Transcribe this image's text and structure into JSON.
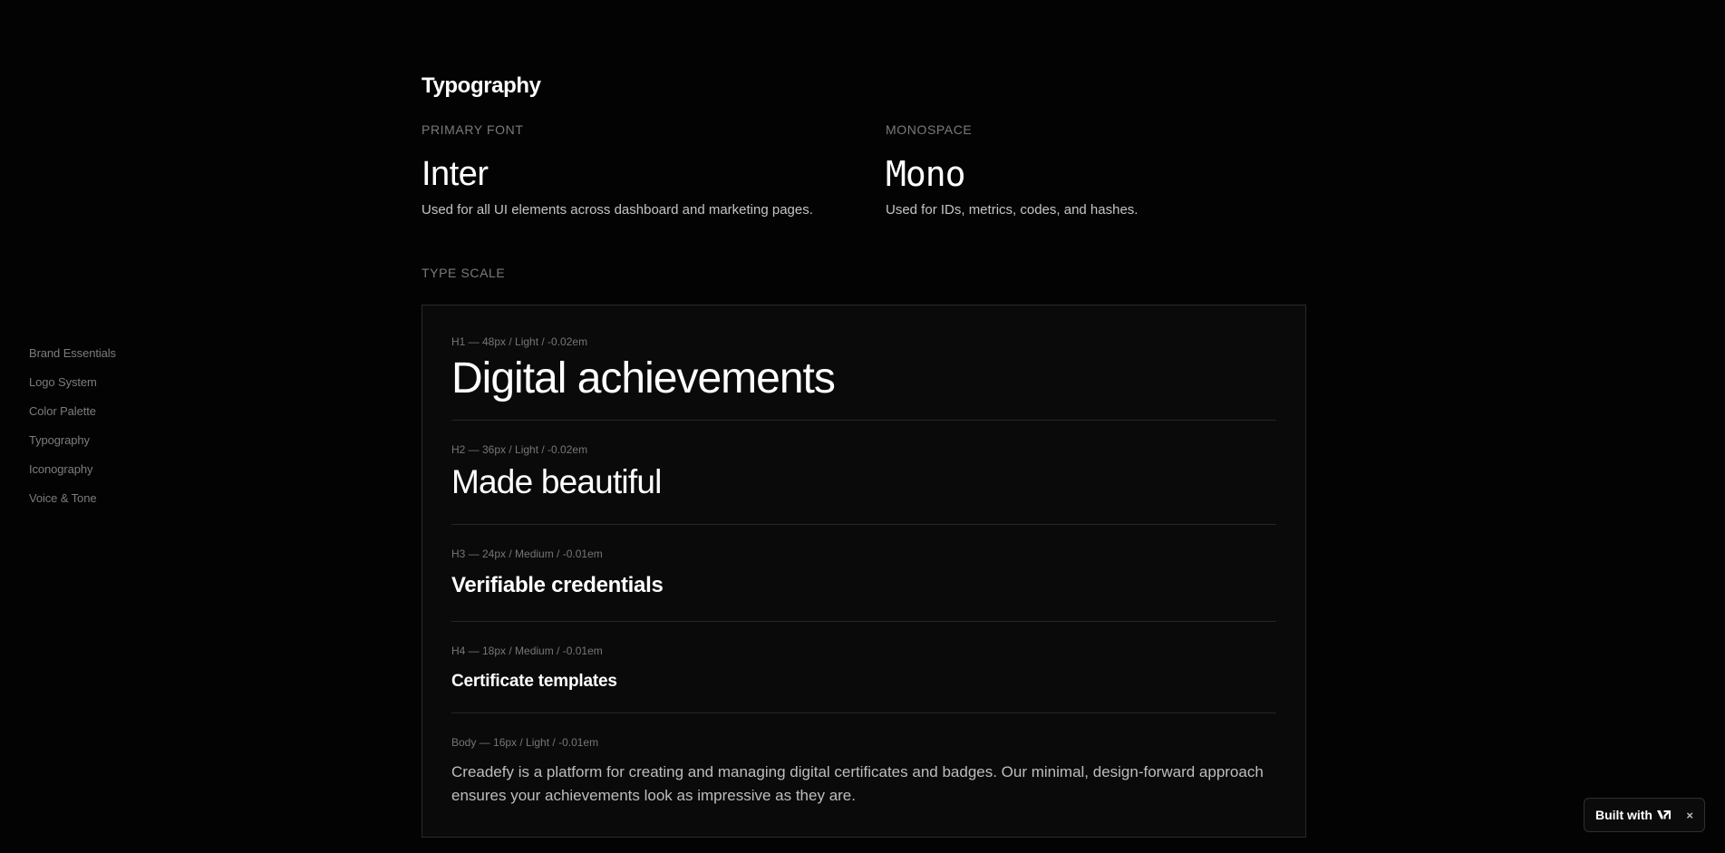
{
  "sidebar": {
    "items": [
      {
        "label": "Brand Essentials"
      },
      {
        "label": "Logo System"
      },
      {
        "label": "Color Palette"
      },
      {
        "label": "Typography"
      },
      {
        "label": "Iconography"
      },
      {
        "label": "Voice & Tone"
      }
    ]
  },
  "main": {
    "title": "Typography",
    "primary_font": {
      "eyebrow": "PRIMARY FONT",
      "name": "Inter",
      "description": "Used for all UI elements across dashboard and marketing pages."
    },
    "monospace_font": {
      "eyebrow": "MONOSPACE",
      "name": "Mono",
      "description": "Used for IDs, metrics, codes, and hashes."
    },
    "type_scale": {
      "label": "TYPE SCALE",
      "rows": [
        {
          "spec": "H1 — 48px / Light / -0.02em",
          "sample": "Digital achievements"
        },
        {
          "spec": "H2 — 36px / Light / -0.02em",
          "sample": "Made beautiful"
        },
        {
          "spec": "H3 — 24px / Medium / -0.01em",
          "sample": "Verifiable credentials"
        },
        {
          "spec": "H4 — 18px / Medium / -0.01em",
          "sample": "Certificate templates"
        },
        {
          "spec": "Body — 16px / Light / -0.01em",
          "sample": "Creadefy is a platform for creating and managing digital certificates and badges. Our minimal, design-forward approach ensures your achievements look as impressive as they are."
        }
      ]
    }
  },
  "badge": {
    "label": "Built with",
    "logo_text": "v0",
    "close_glyph": "×"
  },
  "colors": {
    "background": "#030303",
    "card_background": "#0a0a0a",
    "card_border": "#2a2a2a",
    "muted_text": "#7a7a7a",
    "body_text": "#c4c4c4",
    "heading_text": "#ffffff"
  }
}
